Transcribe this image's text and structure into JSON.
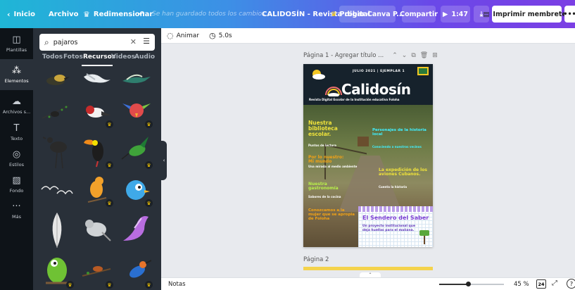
{
  "topbar": {
    "home": "Inicio",
    "file": "Archivo",
    "resize": "Redimensionar",
    "saved": "Se han guardado todos los cambios",
    "doc_title": "CALIDOSÍN - Revista digital",
    "try_canva": "Probar Canva P...",
    "share": "Compartir",
    "play_time": "1:47",
    "print": "Imprimir membretes",
    "more": "•••"
  },
  "rail": {
    "items": [
      {
        "label": "Plantillas",
        "icon": "template-icon"
      },
      {
        "label": "Elementos",
        "icon": "elements-icon"
      },
      {
        "label": "Archivos s...",
        "icon": "upload-icon"
      },
      {
        "label": "Texto",
        "icon": "text-icon"
      },
      {
        "label": "Estilos",
        "icon": "styles-icon"
      },
      {
        "label": "Fondo",
        "icon": "background-icon"
      },
      {
        "label": "Más",
        "icon": "more-icon"
      }
    ]
  },
  "panel": {
    "search_value": "pajaros",
    "tabs": [
      "Todos",
      "Fotos",
      "Recursos",
      "Videos",
      "Audio"
    ],
    "active_tab": "Recursos"
  },
  "editor": {
    "animate": "Animar",
    "duration": "5.0s"
  },
  "canvas": {
    "page1_label": "Página 1 - Agregar título ...",
    "page2_label": "Página 2"
  },
  "cover": {
    "strip": "JULIO 2021 | EJEMPLAR 1",
    "title": "Calidosín",
    "subtitle": "Revista Digital Escolar de la Institución educativa Foloha",
    "t1": "Nuestra biblioteca escolar.",
    "t1b": "Puntos de lectura",
    "t2": "Por lo nuestro: Mi mundo",
    "t2b": "Una mirada al medio ambiente",
    "t3": "Nuestra gastronomía",
    "t3b": "Sabores de la cocina",
    "t4": "Conozcamos a la mujer que se apropia de Foloha",
    "t5": "Personajes de la historia local",
    "t5b": "Conociendo a nuestros vecinos",
    "t6": "La expedición de los aviones Cubanos.",
    "t6b": "Cuenta la historia",
    "box_title": "El Sendero del Saber",
    "box_text": "Un proyecto institucional que deja huellas para el mañana."
  },
  "bottom": {
    "notes": "Notas",
    "zoom": "45 %",
    "zoom_level": 0.45,
    "pages": "24"
  }
}
